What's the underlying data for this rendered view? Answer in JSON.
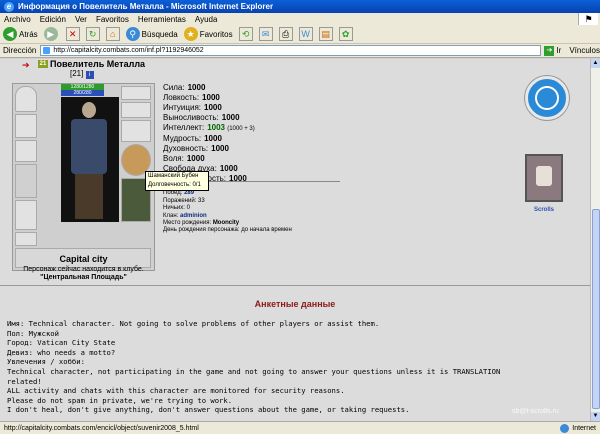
{
  "window": {
    "title": "Информация о Повелитель Металла - Microsoft Internet Explorer"
  },
  "menu": [
    "Archivo",
    "Edición",
    "Ver",
    "Favoritos",
    "Herramientas",
    "Ayuda"
  ],
  "toolbar": {
    "back_label": "Atrás",
    "search_label": "Búsqueda",
    "favorites_label": "Favoritos"
  },
  "address": {
    "label": "Dirección",
    "url": "http://capitalcity.combats.com/inf.pl?1192946052",
    "go_label": "Ir",
    "links_label": "Vínculos"
  },
  "character": {
    "name": "Повелитель Металла",
    "level": "[21]",
    "hp": "1280/1280",
    "mp": "280/280",
    "city": "Capital city",
    "club_text": "Персонаж сейчас находится в клубе.",
    "club_name": "\"Центральная Площадь\""
  },
  "stats": [
    {
      "label": "Сила:",
      "value": "1000"
    },
    {
      "label": "Ловкость:",
      "value": "1000"
    },
    {
      "label": "Интуиция:",
      "value": "1000"
    },
    {
      "label": "Выносливость:",
      "value": "1000"
    },
    {
      "label": "Интеллект:",
      "value": "1003",
      "extra": "(1000 + 3)"
    },
    {
      "label": "Мудрость:",
      "value": "1000"
    },
    {
      "label": "Духовность:",
      "value": "1000"
    },
    {
      "label": "Воля:",
      "value": "1000"
    },
    {
      "label": "Свобода духа:",
      "value": "1000"
    },
    {
      "label": "Божественность:",
      "value": "1000"
    }
  ],
  "tooltip": {
    "line1": "Шаманский Бубен",
    "line2": "Долговечность: 0/1"
  },
  "info": {
    "rank": "Уровень: 21",
    "wins_label": "Побед:",
    "wins": "289",
    "losses": "Поражений: 33",
    "draws": "Ничьих: 0",
    "clan_label": "Клан:",
    "clan": "adminion",
    "birthplace_label": "Место рождения:",
    "birthplace": "Mooncity",
    "birthday": "День рождения персонажа: до начала времен"
  },
  "scrolls_label": "Scrolls",
  "section_title": "Анкетные данные",
  "profile": [
    "Имя: Technical character. Not going to solve problems of other players or assist them.",
    "Пол: Мужской",
    "Город: Vatican City State",
    "Девиз: who needs a motto?",
    "Увлечения / хобби:",
    "Technical character, not participating in the game and not going to answer your questions unless it is TRANSLATION",
    "related!",
    "ALL activity and chats with this character are monitored for security reasons.",
    "Please do not spam in private, we're trying to work.",
    "I don't heal, don't give anything, don't answer questions about the game, or taking requests."
  ],
  "status": {
    "url": "http://capitalcity.combats.com/encicl/object/suvenir2008_5.html",
    "zone": "Internet"
  },
  "watermark": "sb@t-scrolls.ru"
}
